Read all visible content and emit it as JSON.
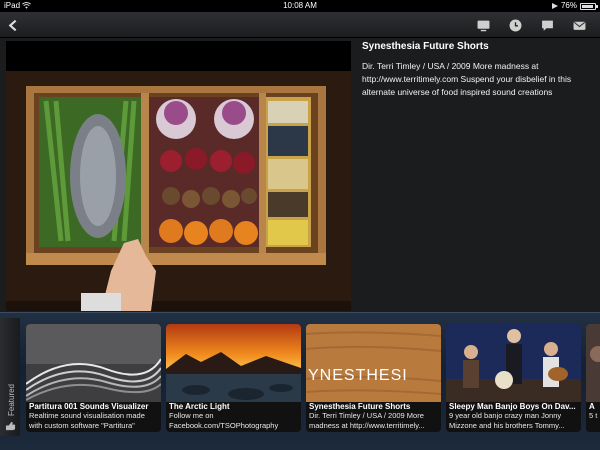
{
  "status": {
    "carrier": "iPad",
    "time": "10:08 AM",
    "battery": "76%",
    "battery_level": 0.76
  },
  "toolbar": {
    "icons": [
      "back-arrow-icon",
      "tv-icon",
      "clock-icon",
      "comment-icon",
      "mail-icon"
    ]
  },
  "video": {
    "title": "Synesthesia Future Shorts",
    "description": "Dir. Terri Timley / USA / 2009 More madness at http://www.territimely.com Suspend your disbelief in this alternate universe of food inspired sound creations"
  },
  "tray": {
    "label": "Featured",
    "cards": [
      {
        "title": "Partitura 001 Sounds Visualizer",
        "desc": "Realtime sound visualisation made with custom software \"Partitura\""
      },
      {
        "title": "The Arctic Light",
        "desc": "Follow me on Facebook.com/TSOPhotography"
      },
      {
        "title": "Synesthesia Future Shorts",
        "desc": "Dir. Terri Timley / USA / 2009 More madness at http://www.territimely...",
        "thumb_text": "YNESTHESI"
      },
      {
        "title": "Sleepy Man Banjo Boys On Dav...",
        "desc": "9 year old banjo crazy man Jonny Mizzone and his brothers Tommy..."
      },
      {
        "title": "A",
        "desc": "5 t"
      }
    ]
  }
}
